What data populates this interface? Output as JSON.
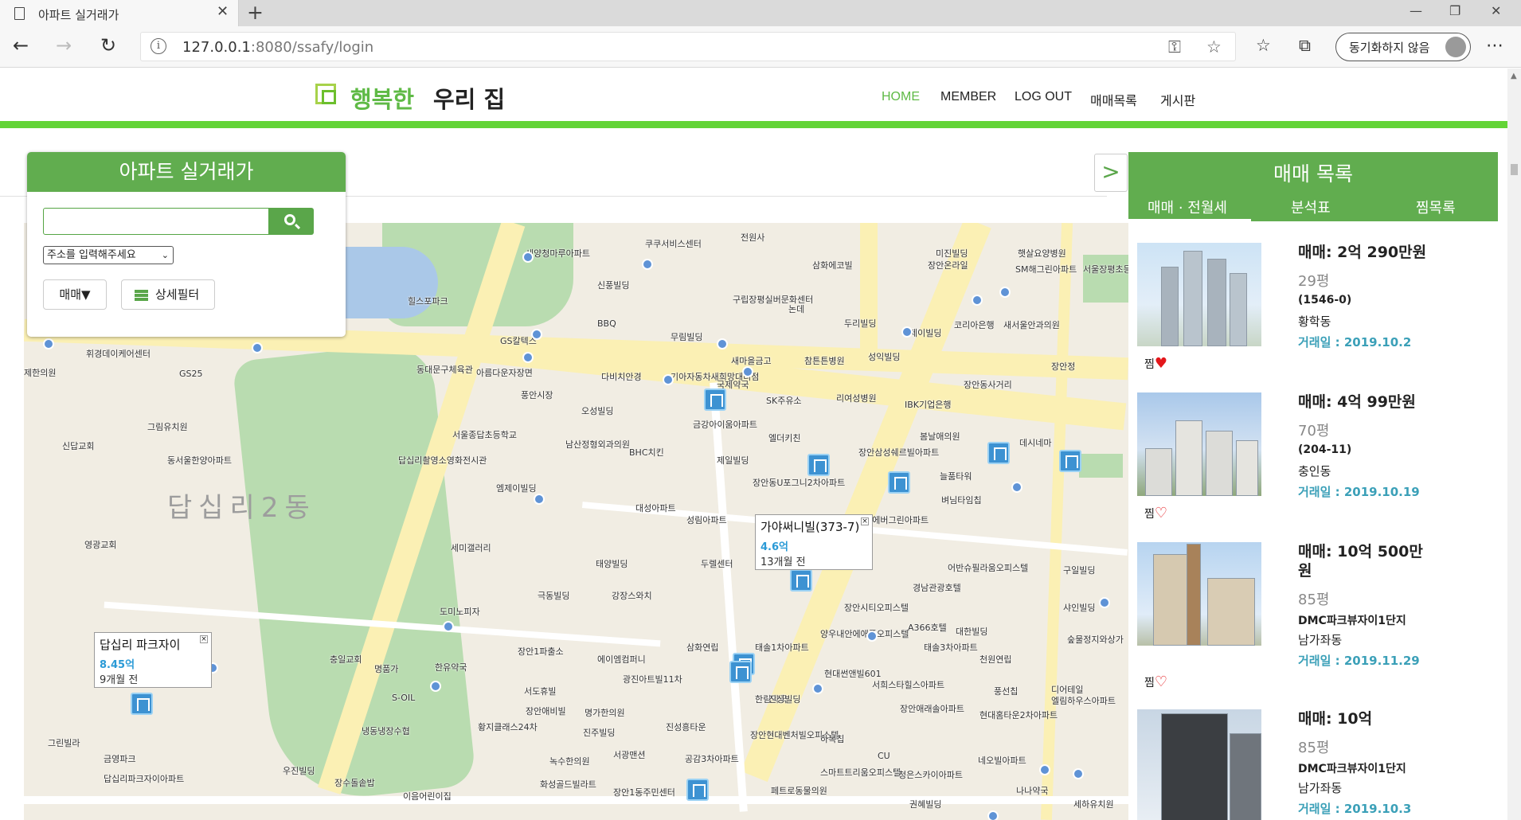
{
  "browser": {
    "tab_title": "아파트 실거래가",
    "url_host": "127.0.0.1",
    "url_rest": ":8080/ssafy/login",
    "sync_label": "동기화하지 않음"
  },
  "header": {
    "logo_a": "행복한",
    "logo_b": "우리 집",
    "nav": [
      "HOME",
      "MEMBER",
      "LOG OUT",
      "매매목록",
      "게시판"
    ]
  },
  "search_panel": {
    "title": "아파트 실거래가",
    "address_select": "주소를 입력해주세요",
    "deal_button": "매매▼",
    "filter_button": "상세필터"
  },
  "map": {
    "dong_name": "답십리2동",
    "infowindows": [
      {
        "name": "가야써니빌(373-7)",
        "price": "4.6억",
        "time": "13개월 전"
      },
      {
        "name": "답십리 파크자이",
        "price": "8.45억",
        "time": "9개월 전"
      }
    ],
    "labels": [
      "세양청마루아파트",
      "신풍빌딩",
      "구립장평실버문화센터",
      "논데",
      "두리빌딩",
      "힐스포파크",
      "BBQ",
      "무림빌딩",
      "GS칼텍스",
      "동대문구체육관",
      "아름다운자장면",
      "다비치안경",
      "새마을금고",
      "참튼튼병원",
      "성익빌딩",
      "제이빌딩",
      "코리아은행",
      "새서울안과의원",
      "장안정",
      "장안동사거리",
      "휘경데이케어센터",
      "제한의원",
      "GS25",
      "풍안시장",
      "오성빌딩",
      "기아자동차새희망대리점",
      "국제약국",
      "SK주유소",
      "리여성병원",
      "IBK기업은행",
      "그림유치원",
      "신답교회",
      "서울종답초등학교",
      "남산정형외과의원",
      "BHC치킨",
      "금강아이움아파트",
      "엘더키친",
      "제일빌딩",
      "장안삼성쉐르빌아파트",
      "봄날애의원",
      "데시네마",
      "동서울한양아파트",
      "답십리촬영소영화전시관",
      "엠제이빌딩",
      "장안동U포그니2차아파트",
      "늘품타워",
      "벼님타임칩",
      "대성아파트",
      "성림아파트",
      "청면에버그린아파트",
      "영광교회",
      "세미갤러리",
      "태양빌딩",
      "두렐센터",
      "가야써니빌",
      "어반슈필라움오피스텔",
      "구일빌딩",
      "도미노피자",
      "극동빌딩",
      "강장스와치",
      "삼화연립",
      "장안시티오피스텔",
      "경남관광호텔",
      "A366호텔",
      "대한빌딩",
      "샤인빌딩",
      "충일교회",
      "명품가",
      "한유약국",
      "장안1파출소",
      "에이엠컴퍼니",
      "양우내안에애플오피스텔",
      "태솔1차아파트",
      "태솔3차아파트",
      "천원연립",
      "숲물정지와상가",
      "서도휴빌",
      "광진아트빌11차",
      "한림약국",
      "현대썬앤빌601",
      "서희스타힐스아파트",
      "풍선칩",
      "디어테일",
      "S-OIL",
      "냉동냉장수협",
      "장안애비빌",
      "명가한의원",
      "진성흥타운",
      "진성빌딩",
      "장안애래솔아파트",
      "현대홈타운2차아파트",
      "엘림하우스아파트",
      "그린빌라",
      "금영파크",
      "황지클래스24차",
      "진주빌딩",
      "서광맨션",
      "장안현대벤처빌오피스텔",
      "하복칩",
      "CU",
      "네오빌아파트",
      "답십리파크자이아파트",
      "공감3차아파트",
      "스마트트리움오피스텔",
      "청은스카이아파트",
      "나나약국",
      "녹수한의원",
      "우진빌딩",
      "장수돌솥밥",
      "이음어린이집",
      "화성골드빌라트",
      "장안1동주민센터",
      "페트로동물의원",
      "권혜빌딩",
      "세하유치원",
      "미진빌딩",
      "장안온라일",
      "햇살요양병원",
      "SM해그린아파트",
      "서울장평초등학교",
      "전원사",
      "삼화에코빌",
      "쿠쿠서비스센터",
      "영광교회"
    ]
  },
  "list": {
    "title": "매매 목록",
    "tabs": [
      "매매 · 전월세",
      "분석표",
      "찜목록"
    ],
    "zzim_label": "찜",
    "items": [
      {
        "price": "매매: 2억 290만원",
        "area": "29평",
        "code": "(1546-0)",
        "dong": "황학동",
        "date": "거래일 : 2019.10.2",
        "liked": true
      },
      {
        "price": "매매: 4억 99만원",
        "area": "70평",
        "code": "(204-11)",
        "dong": "충인동",
        "date": "거래일 : 2019.10.19",
        "liked": false
      },
      {
        "price": "매매: 10억 500만원",
        "area": "85평",
        "code": "DMC파크뷰자이1단지",
        "dong": "남가좌동",
        "date": "거래일 : 2019.11.29",
        "liked": false
      },
      {
        "price": "매매: 10억",
        "area": "85평",
        "code": "DMC파크뷰자이1단지",
        "dong": "남가좌동",
        "date": "거래일 : 2019.10.3",
        "liked": false
      }
    ]
  }
}
